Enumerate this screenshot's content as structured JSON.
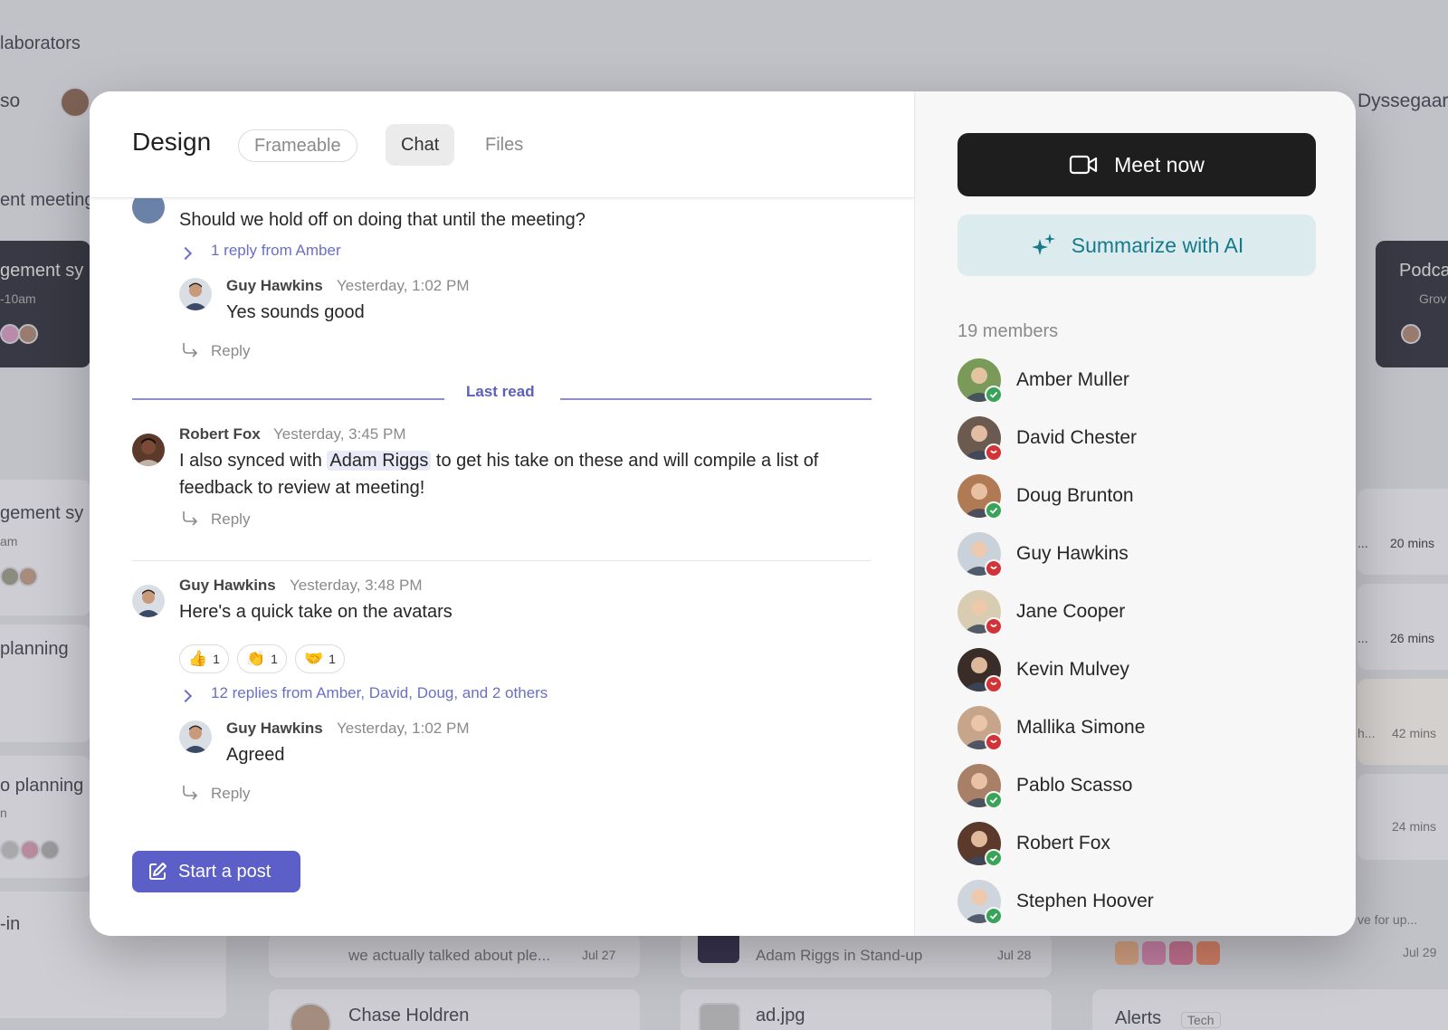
{
  "background": {
    "items": [
      {
        "text": "laborators"
      },
      {
        "text": "so"
      },
      {
        "text": "Dyssegaar"
      },
      {
        "text": "ent meeting"
      },
      {
        "text": "gement sy"
      },
      {
        "text": "-10am"
      },
      {
        "text": "Podca"
      },
      {
        "text": "Grov"
      },
      {
        "text": "gement sy"
      },
      {
        "text": "am"
      },
      {
        "text": "planning"
      },
      {
        "text": "o planning"
      },
      {
        "text": "n"
      },
      {
        "text": "-in"
      },
      {
        "text": "20 mins"
      },
      {
        "text": "26 mins"
      },
      {
        "text": "42 mins"
      },
      {
        "text": "24 mins"
      },
      {
        "text": "ve for up..."
      },
      {
        "text": "Jul 29"
      },
      {
        "text": "we actually talked about ple..."
      },
      {
        "text": "Jul 27"
      },
      {
        "text": "Adam Riggs in Stand-up"
      },
      {
        "text": "Jul 28"
      },
      {
        "text": "Chase Holdren"
      },
      {
        "text": "ad.jpg"
      },
      {
        "text": "Alerts"
      },
      {
        "text": "Tech"
      },
      {
        "text": "..."
      },
      {
        "text": "..."
      },
      {
        "text": "h..."
      }
    ]
  },
  "channel": {
    "title": "Design",
    "tabs": [
      {
        "label": "Frameable"
      },
      {
        "label": "Chat"
      },
      {
        "label": "Files"
      }
    ]
  },
  "messages": {
    "partial": {
      "text": "Should we hold off on doing that until the meeting?",
      "thread": "1 reply from Amber"
    },
    "reply1": {
      "name": "Guy Hawkins",
      "time": "Yesterday, 1:02 PM",
      "text": "Yes sounds good",
      "reply_label": "Reply"
    },
    "last_read": "Last read",
    "msg2": {
      "name": "Robert Fox",
      "time": "Yesterday, 3:45 PM",
      "text_before": "I also synced with ",
      "mention": "Adam Riggs",
      "text_after": " to get his take on these and will compile a list of",
      "text_line2": "feedback to review at meeting!",
      "reply_label": "Reply"
    },
    "msg3": {
      "name": "Guy Hawkins",
      "time": "Yesterday, 3:48 PM",
      "text": "Here's a quick take on the avatars",
      "reactions": [
        {
          "emoji": "👍",
          "count": "1"
        },
        {
          "emoji": "👏",
          "count": "1"
        },
        {
          "emoji": "🤝",
          "count": "1"
        }
      ],
      "thread": "12 replies from Amber, David, Doug, and 2 others"
    },
    "reply3": {
      "name": "Guy Hawkins",
      "time": "Yesterday, 1:02 PM",
      "text": "Agreed",
      "reply_label": "Reply"
    }
  },
  "composer": {
    "start_post": "Start a post"
  },
  "sidebar": {
    "meet_now": "Meet now",
    "summarize": "Summarize with AI",
    "members_count": "19 members",
    "members": [
      {
        "name": "Amber Muller",
        "status": "online",
        "color": "#7a9a5a"
      },
      {
        "name": "David Chester",
        "status": "busy",
        "color": "#6b5a50"
      },
      {
        "name": "Doug Brunton",
        "status": "online",
        "color": "#b07a55"
      },
      {
        "name": "Guy Hawkins",
        "status": "busy",
        "color": "#c9d2da"
      },
      {
        "name": "Jane Cooper",
        "status": "busy",
        "color": "#d8cdb2"
      },
      {
        "name": "Kevin Mulvey",
        "status": "busy",
        "color": "#3a2d28"
      },
      {
        "name": "Mallika Simone",
        "status": "busy",
        "color": "#c7a58a"
      },
      {
        "name": "Pablo Scasso",
        "status": "online",
        "color": "#a88068"
      },
      {
        "name": "Robert Fox",
        "status": "online",
        "color": "#5b3a2c"
      },
      {
        "name": "Stephen Hoover",
        "status": "online",
        "color": "#cfd5dc"
      }
    ]
  },
  "colors": {
    "accent": "#5b5fc7",
    "online": "#3aa35a",
    "busy": "#d13438",
    "ai_text": "#177a8c"
  }
}
